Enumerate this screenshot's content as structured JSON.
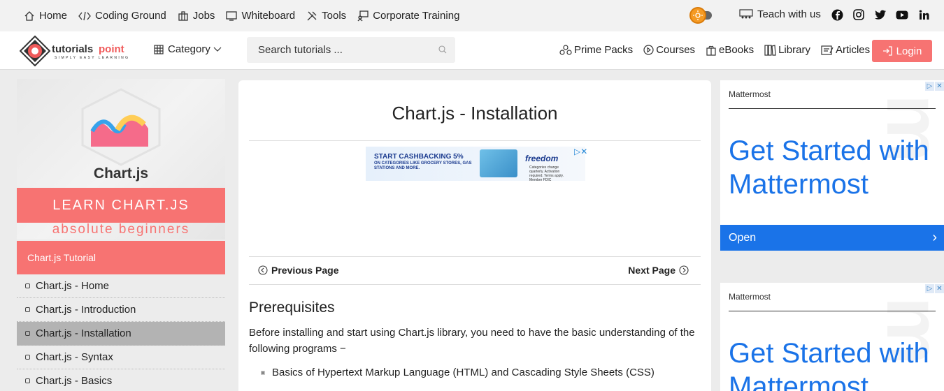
{
  "topbar": {
    "links": [
      {
        "label": "Home",
        "icon": "home-icon"
      },
      {
        "label": "Coding Ground",
        "icon": "code-icon"
      },
      {
        "label": "Jobs",
        "icon": "briefcase-icon"
      },
      {
        "label": "Whiteboard",
        "icon": "whiteboard-icon"
      },
      {
        "label": "Tools",
        "icon": "tools-icon"
      },
      {
        "label": "Corporate Training",
        "icon": "training-icon"
      }
    ],
    "teach_label": "Teach with us",
    "social": [
      "facebook-icon",
      "instagram-icon",
      "twitter-icon",
      "youtube-icon",
      "linkedin-icon"
    ]
  },
  "header": {
    "logo_text": "tutorialspoint",
    "logo_tagline": "SIMPLY EASY LEARNING",
    "category_label": "Category",
    "search_placeholder": "Search tutorials ...",
    "nav": [
      {
        "label": "Prime Packs",
        "icon": "prime-packs-icon"
      },
      {
        "label": "Courses",
        "icon": "play-circle-icon"
      },
      {
        "label": "eBooks",
        "icon": "ebook-icon"
      },
      {
        "label": "Library",
        "icon": "library-icon"
      },
      {
        "label": "Articles",
        "icon": "articles-icon"
      }
    ],
    "login_label": "Login"
  },
  "sidebar": {
    "banner_title": "Chart.js",
    "banner_learn": "LEARN CHART.JS",
    "banner_sub": "absolute beginners",
    "section_title": "Chart.js Tutorial",
    "items": [
      {
        "label": "Chart.js - Home"
      },
      {
        "label": "Chart.js - Introduction"
      },
      {
        "label": "Chart.js - Installation",
        "active": true
      },
      {
        "label": "Chart.js - Syntax"
      },
      {
        "label": "Chart.js - Basics"
      }
    ]
  },
  "main": {
    "title": "Chart.js - Installation",
    "ad": {
      "headline": "START CASHBACKING 5%",
      "sub": "ON CATEGORIES LIKE GROCERY STORES, GAS STATIONS AND MORE.",
      "brand": "freedom",
      "fine": "Categories change quarterly. Activation required. Terms apply. Member FDIC"
    },
    "prev_label": "Previous Page",
    "next_label": "Next Page",
    "heading": "Prerequisites",
    "paragraph": "Before installing and start using Chart.js library, you need to have the basic understanding of the following programs −",
    "bullets": [
      "Basics of Hypertext Markup Language (HTML) and Cascading Style Sheets (CSS)"
    ]
  },
  "ads_right": [
    {
      "brand": "Mattermost",
      "headline": "Get Started with Mattermost",
      "cta": "Open"
    },
    {
      "brand": "Mattermost",
      "headline": "Get Started with Mattermost"
    }
  ],
  "colors": {
    "accent": "#f77372",
    "ad_blue": "#1a73e8"
  }
}
